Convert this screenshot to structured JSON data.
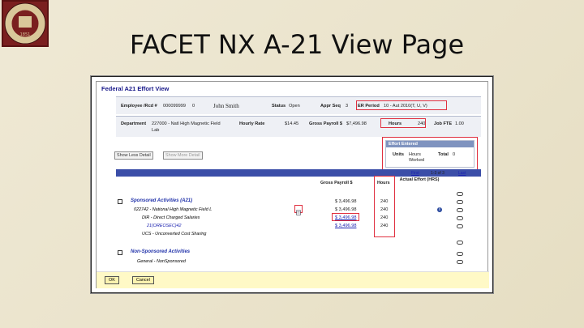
{
  "slide": {
    "title": "FACET NX A-21 View Page"
  },
  "logo": {
    "text": "FLORIDA STATE UNIVERSITY",
    "year": "1851"
  },
  "page": {
    "header": "Federal A21 Effort View"
  },
  "employee": {
    "label": "Employee /Rcd #",
    "id": "000099999",
    "rcd": "0",
    "name": "John Smith",
    "status_label": "Status",
    "status": "Open",
    "appr_label": "Appr Seq",
    "appr": "3",
    "er_label": "ER Period",
    "er": "10 - Aut 2010(T, U, V)"
  },
  "dept": {
    "label": "Department",
    "value": "227000 - Natl High Magnetic Field",
    "value2": "Lab",
    "rate_label": "Hourly Rate",
    "rate": "$14.45",
    "gross_label": "Gross Payroll $",
    "gross": "$7,496.98",
    "hours_label": "Hours",
    "hours": "240",
    "fte_label": "Job FTE",
    "fte": "1.00"
  },
  "effort": {
    "header": "Effort Entered",
    "units_label": "Units",
    "units": "Hours Worked",
    "total_label": "Total",
    "total": "0"
  },
  "buttons": {
    "show_less": "Show Less Detail",
    "show_more": "Show More Detail",
    "ok": "OK",
    "cancel": "Cancel"
  },
  "nav": {
    "first": "First",
    "range": "1-3 of 3",
    "last": "Last"
  },
  "grid": {
    "gross_hdr": "Gross Payroll $",
    "hours_hdr": "Hours",
    "actual_hdr": "Actual Effort (HRS)"
  },
  "rows": {
    "sponsored": "Sponsored Activities (A21)",
    "r1": {
      "label": "022742 - National High Magnetic Field L",
      "gross": "$ 3,496.98",
      "hours": "240"
    },
    "r2": {
      "label": "DIR - Direct Charged Salaries",
      "gross": "$ 3,496.98",
      "hours": "240"
    },
    "r3": {
      "label": "21(OREOSEC)42",
      "gross": "$ 3,496.98",
      "hours": "240"
    },
    "r4": {
      "label": "UCS - Unconverted Cost Sharing"
    },
    "top_gross": "$ 3,496.98",
    "top_hours": "240",
    "nonsponsored": "Non-Sponsored Activities",
    "general": "General - NonSponsored"
  },
  "colors": {
    "accent": "#3b4ea8",
    "highlight": "#e03040",
    "footer": "#fff9c6"
  }
}
